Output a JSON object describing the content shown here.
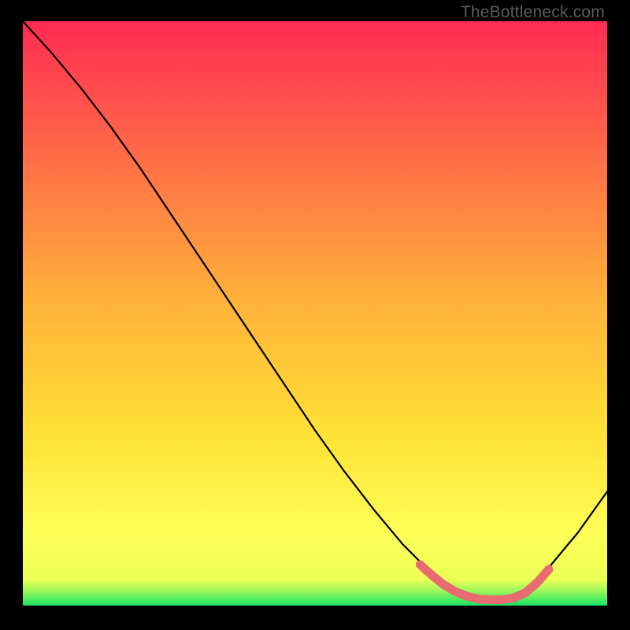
{
  "watermark": "TheBottleneck.com",
  "chart_data": {
    "type": "line",
    "title": "",
    "xlabel": "",
    "ylabel": "",
    "xlim": [
      0,
      100
    ],
    "ylim": [
      0,
      100
    ],
    "grid": false,
    "legend": false,
    "background_gradient": {
      "top_color": "#ff2b53",
      "mid_color": "#ffd531",
      "lower_color": "#fbff3a",
      "bottom_color": "#17e564"
    },
    "series": [
      {
        "name": "bottleneck-curve",
        "color": "#000000",
        "x": [
          0,
          5,
          10,
          15,
          20,
          25,
          30,
          35,
          40,
          45,
          50,
          55,
          60,
          65,
          68,
          70,
          72,
          75,
          78,
          80,
          82,
          84,
          85,
          90,
          95,
          100
        ],
        "y": [
          100,
          94.5,
          88.5,
          82,
          75,
          67.5,
          60,
          52.5,
          45,
          37.5,
          30,
          23,
          16.5,
          10.5,
          7.5,
          5.5,
          3.8,
          2.0,
          1.2,
          1.0,
          1.0,
          1.4,
          2.0,
          6.5,
          12.5,
          19.5
        ]
      },
      {
        "name": "optimal-zone-highlight",
        "color": "#e86b70",
        "style": "dotted-thick",
        "x": [
          68,
          70,
          72,
          74,
          76,
          78,
          80,
          82,
          84,
          86,
          88,
          90
        ],
        "y": [
          7.0,
          5.2,
          3.6,
          2.4,
          1.6,
          1.1,
          1.0,
          1.0,
          1.3,
          2.2,
          3.9,
          6.2
        ]
      }
    ]
  }
}
